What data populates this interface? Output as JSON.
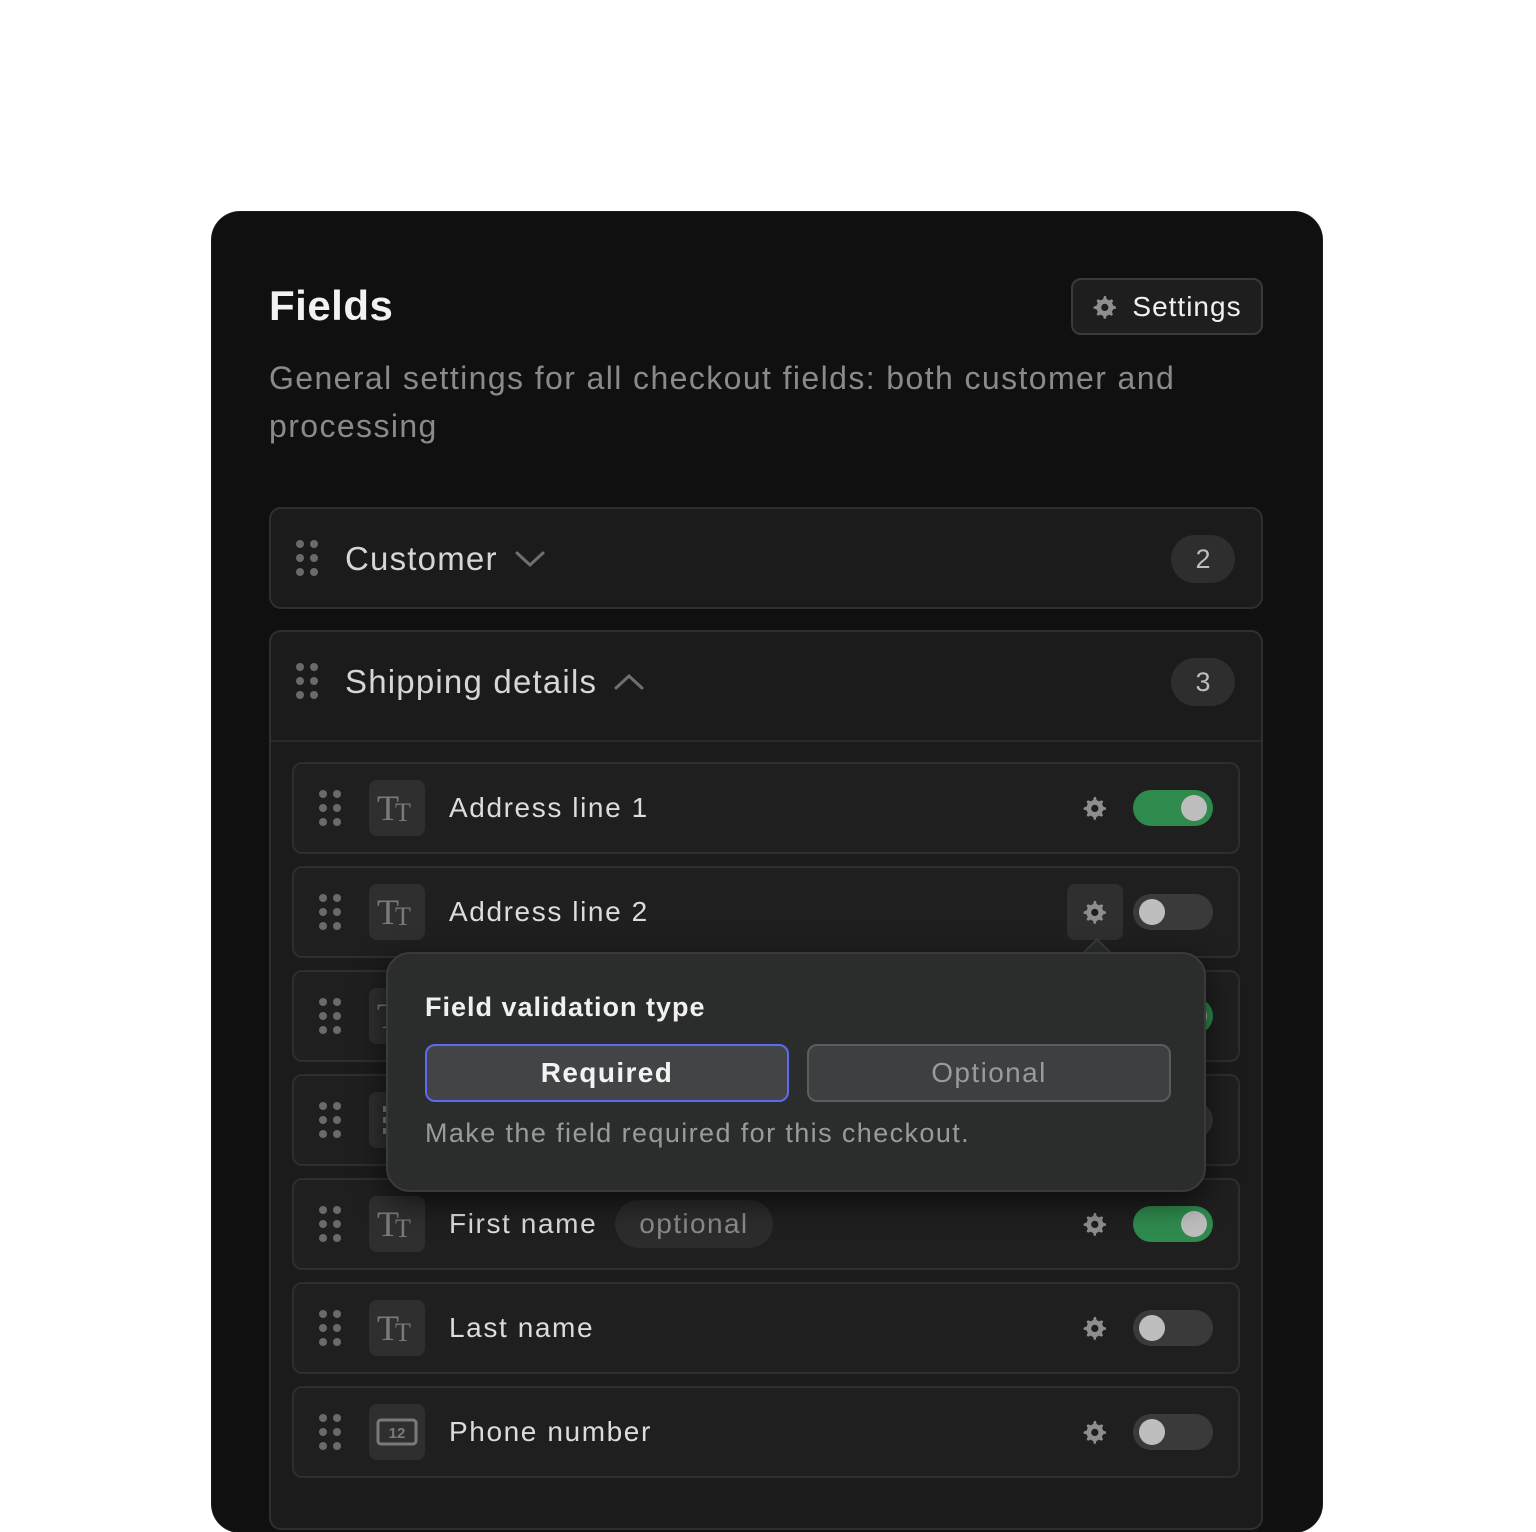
{
  "header": {
    "title": "Fields",
    "settings_label": "Settings",
    "description": "General settings for all checkout fields: both customer and processing"
  },
  "groups": [
    {
      "title": "Customer",
      "count": "2",
      "expanded": false
    },
    {
      "title": "Shipping details",
      "count": "3",
      "expanded": true
    }
  ],
  "fields": [
    {
      "label": "Address line 1",
      "type_icon": "text-type-icon",
      "enabled": true,
      "chip": ""
    },
    {
      "label": "Address line 2",
      "type_icon": "text-type-icon",
      "enabled": false,
      "chip": ""
    },
    {
      "label": "",
      "type_icon": "text-type-icon",
      "enabled": true,
      "chip": ""
    },
    {
      "label": "",
      "type_icon": "list-type-icon",
      "enabled": false,
      "chip": ""
    },
    {
      "label": "First name",
      "type_icon": "text-type-icon",
      "enabled": true,
      "chip": "optional"
    },
    {
      "label": "Last name",
      "type_icon": "text-type-icon",
      "enabled": false,
      "chip": ""
    },
    {
      "label": "Phone number",
      "type_icon": "number-type-icon",
      "enabled": false,
      "chip": ""
    }
  ],
  "popover": {
    "title": "Field validation type",
    "options": [
      "Required",
      "Optional"
    ],
    "selected": "Required",
    "description": "Make the field required for this checkout."
  },
  "colors": {
    "panel_bg": "#101010",
    "toggle_on": "#2f8a4e",
    "selected_outline": "#5a6cf2"
  }
}
